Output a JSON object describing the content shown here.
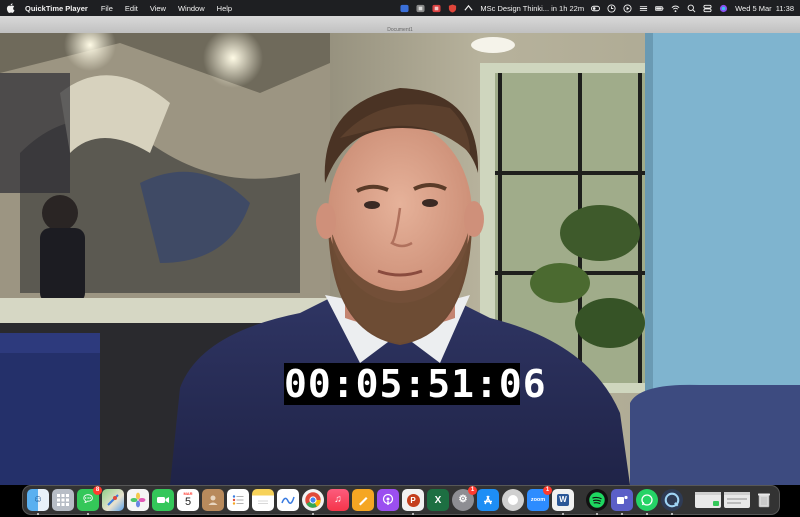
{
  "menubar": {
    "app_name": "QuickTime Player",
    "menus": [
      "File",
      "Edit",
      "View",
      "Window",
      "Help"
    ],
    "event_text": "MSc Design Thinki... in 1h 22m",
    "date_time": "Wed 5 Mar  11:38"
  },
  "window": {
    "title": "Document1"
  },
  "video": {
    "timecode": "00:05:51:06"
  },
  "dock": {
    "messages_badge": "8",
    "calendar_month": "MAR",
    "calendar_day": "5",
    "settings_badge": "1",
    "zoom_label": "zoom",
    "zoom_badge": "1",
    "word_label": "W",
    "powerpoint_label": "P",
    "excel_label": "X"
  },
  "colors": {
    "menubar_bg": "#1e1f22",
    "dock_bg": "#3c3c3c",
    "badge_red": "#ff3b30",
    "timecode_bg": "#000000"
  }
}
